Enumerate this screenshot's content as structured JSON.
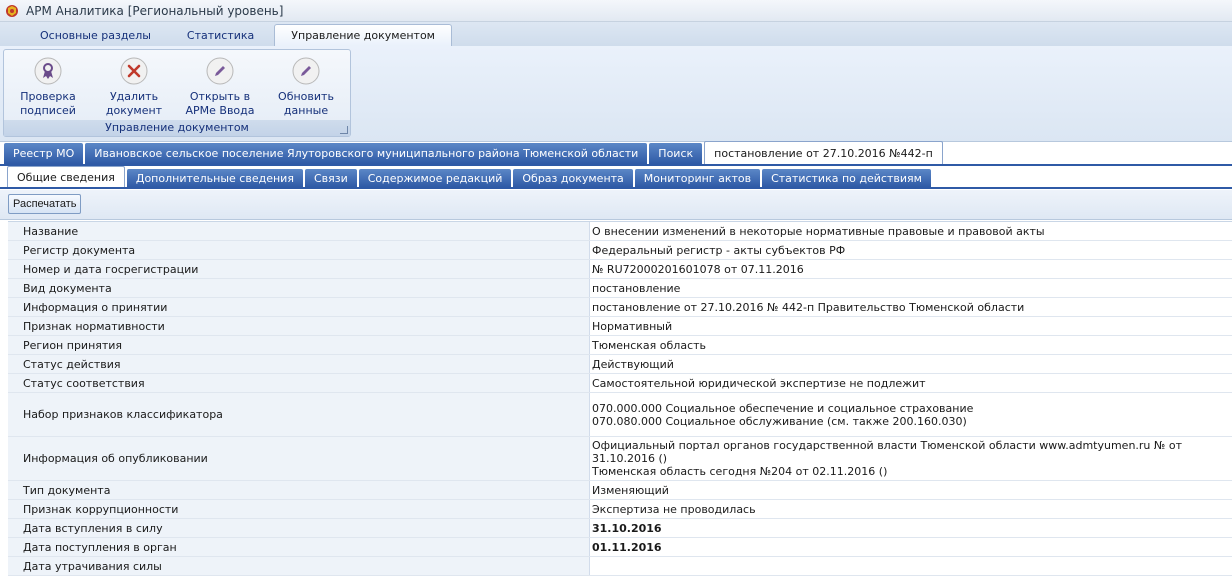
{
  "window": {
    "title": "АРМ Аналитика [Региональный уровень]",
    "icon": "app-emblem-icon"
  },
  "ribbon_tabs": [
    {
      "label": "Основные разделы",
      "active": false
    },
    {
      "label": "Статистика",
      "active": false
    },
    {
      "label": "Управление документом",
      "active": true
    }
  ],
  "ribbon_group": {
    "label": "Управление документом",
    "buttons": [
      {
        "label": "Проверка подписей",
        "icon": "signature-ribbon-icon"
      },
      {
        "label": "Удалить документ",
        "icon": "delete-x-icon"
      },
      {
        "label": "Открыть в АРМе Ввода",
        "icon": "pencil-icon"
      },
      {
        "label": "Обновить данные",
        "icon": "pencil-icon"
      }
    ]
  },
  "doc_tabs": [
    {
      "label": "Реестр МО",
      "active": false
    },
    {
      "label": "Ивановское сельское поселение Ялуторовского муниципального района Тюменской области",
      "active": false
    },
    {
      "label": "Поиск",
      "active": false
    },
    {
      "label": "постановление от 27.10.2016 №442-п",
      "active": true
    }
  ],
  "inner_tabs": [
    {
      "label": "Общие сведения",
      "active": true
    },
    {
      "label": "Дополнительные сведения",
      "active": false
    },
    {
      "label": "Связи",
      "active": false
    },
    {
      "label": "Содержимое редакций",
      "active": false
    },
    {
      "label": "Образ документа",
      "active": false
    },
    {
      "label": "Мониторинг актов",
      "active": false
    },
    {
      "label": "Статистика по действиям",
      "active": false
    }
  ],
  "toolbar": {
    "print_label": "Распечатать"
  },
  "properties": [
    {
      "name": "Название",
      "values": [
        "О внесении изменений в некоторые нормативные правовые и правовой акты"
      ]
    },
    {
      "name": "Регистр документа",
      "values": [
        "Федеральный регистр - акты субъектов РФ"
      ]
    },
    {
      "name": "Номер и дата госрегистрации",
      "values": [
        "№ RU72000201601078 от 07.11.2016"
      ]
    },
    {
      "name": "Вид документа",
      "values": [
        "постановление"
      ]
    },
    {
      "name": "Информация о принятии",
      "values": [
        "постановление от 27.10.2016 № 442-п Правительство Тюменской области"
      ]
    },
    {
      "name": "Признак нормативности",
      "values": [
        "Нормативный"
      ]
    },
    {
      "name": "Регион принятия",
      "values": [
        "Тюменская область"
      ]
    },
    {
      "name": "Статус действия",
      "values": [
        "Действующий"
      ]
    },
    {
      "name": "Статус соответствия",
      "values": [
        "Самостоятельной юридической экспертизе не подлежит"
      ]
    },
    {
      "name": "Набор признаков классификатора",
      "values": [
        "070.000.000 Социальное обеспечение и социальное страхование",
        "070.080.000 Социальное обслуживание (см. также 200.160.030)"
      ]
    },
    {
      "name": "Информация об опубликовании",
      "values": [
        "Официальный портал органов государственной власти Тюменской области www.admtyumen.ru № от 31.10.2016 ()",
        "Тюменская область сегодня №204 от 02.11.2016 ()"
      ]
    },
    {
      "name": "Тип документа",
      "values": [
        "Изменяющий"
      ]
    },
    {
      "name": "Признак коррупционности",
      "values": [
        "Экспертиза не проводилась"
      ]
    },
    {
      "name": "Дата вступления в силу",
      "values": [
        "31.10.2016"
      ]
    },
    {
      "name": "Дата поступления в орган",
      "values": [
        "01.11.2016"
      ]
    },
    {
      "name": "Дата утрачивания силы",
      "values": [
        ""
      ]
    }
  ]
}
